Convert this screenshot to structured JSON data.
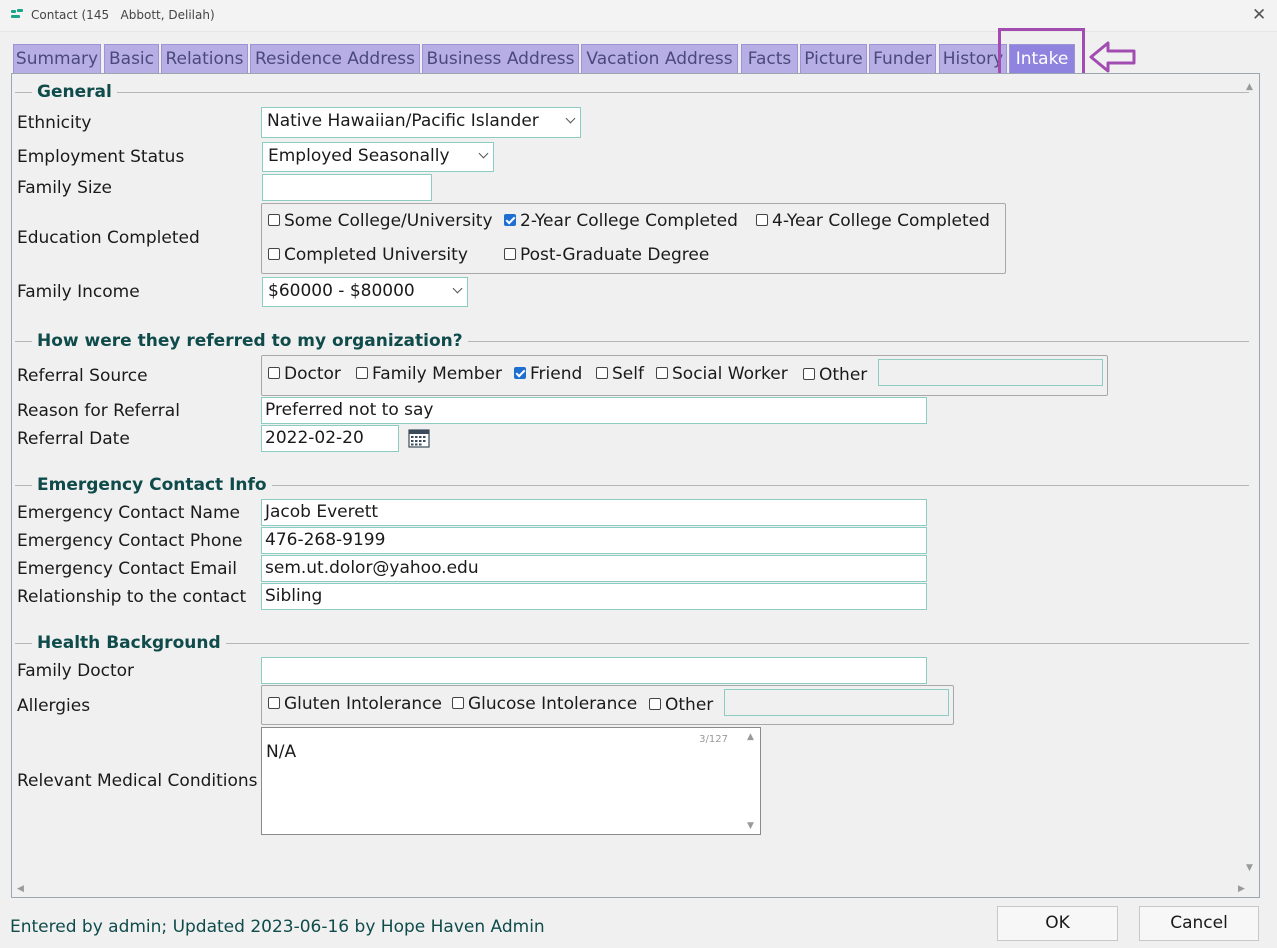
{
  "window": {
    "title": "Contact (145   Abbott, Delilah)",
    "close_glyph": "✕"
  },
  "tabs": [
    {
      "label": "Summary"
    },
    {
      "label": "Basic"
    },
    {
      "label": "Relations"
    },
    {
      "label": "Residence Address"
    },
    {
      "label": "Business Address"
    },
    {
      "label": "Vacation Address"
    },
    {
      "label": "Facts"
    },
    {
      "label": "Picture"
    },
    {
      "label": "Funder"
    },
    {
      "label": "History"
    },
    {
      "label": "Intake",
      "active": true
    }
  ],
  "sections": {
    "general": "General",
    "referral": "How were they referred to my organization?",
    "emergency": "Emergency Contact Info",
    "health": "Health Background"
  },
  "general": {
    "ethnicity_label": "Ethnicity",
    "ethnicity_value": "Native Hawaiian/Pacific Islander",
    "employment_label": "Employment Status",
    "employment_value": "Employed Seasonally",
    "family_size_label": "Family Size",
    "family_size_value": "",
    "education_label": "Education Completed",
    "education_options": [
      {
        "label": "Some College/University",
        "checked": false
      },
      {
        "label": "2-Year College Completed",
        "checked": true
      },
      {
        "label": "4-Year College Completed",
        "checked": false
      },
      {
        "label": "Completed University",
        "checked": false
      },
      {
        "label": "Post-Graduate Degree",
        "checked": false
      }
    ],
    "income_label": "Family Income",
    "income_value": "$60000 - $80000"
  },
  "referral": {
    "source_label": "Referral Source",
    "source_options": [
      {
        "label": "Doctor",
        "checked": false
      },
      {
        "label": "Family Member",
        "checked": false
      },
      {
        "label": "Friend",
        "checked": true
      },
      {
        "label": "Self",
        "checked": false
      },
      {
        "label": "Social Worker",
        "checked": false
      },
      {
        "label": "Other",
        "checked": false
      }
    ],
    "source_other_value": "",
    "reason_label": "Reason for Referral",
    "reason_value": "Preferred not to say",
    "date_label": "Referral Date",
    "date_value": "2022-02-20"
  },
  "emergency": {
    "name_label": "Emergency Contact Name",
    "name_value": "Jacob Everett",
    "phone_label": "Emergency Contact Phone",
    "phone_value": "476-268-9199",
    "email_label": "Emergency Contact Email",
    "email_value": "sem.ut.dolor@yahoo.edu",
    "relationship_label": "Relationship to the contact",
    "relationship_value": "Sibling"
  },
  "health": {
    "doctor_label": "Family Doctor",
    "doctor_value": "",
    "allergies_label": "Allergies",
    "allergy_options": [
      {
        "label": "Gluten Intolerance",
        "checked": false
      },
      {
        "label": "Glucose Intolerance",
        "checked": false
      },
      {
        "label": "Other",
        "checked": false
      }
    ],
    "allergy_other_value": "",
    "conditions_label": "Relevant Medical Conditions",
    "conditions_value": "N/A",
    "conditions_counter": "3/127"
  },
  "footer": {
    "status": "Entered by admin; Updated 2023-06-16 by Hope Haven Admin",
    "ok_label": "OK",
    "cancel_label": "Cancel"
  },
  "colors": {
    "tab": "#b8aee6",
    "tab_active": "#8f83e0",
    "annotation": "#a24bb0",
    "section_title": "#0f4b4b",
    "field_border": "#8ccdc3",
    "checkbox_checked": "#1f6fd1"
  },
  "icons": {
    "app": "app-logo-icon",
    "close": "close-icon",
    "calendar": "calendar-icon",
    "annotation_arrow": "left-arrow-icon"
  }
}
